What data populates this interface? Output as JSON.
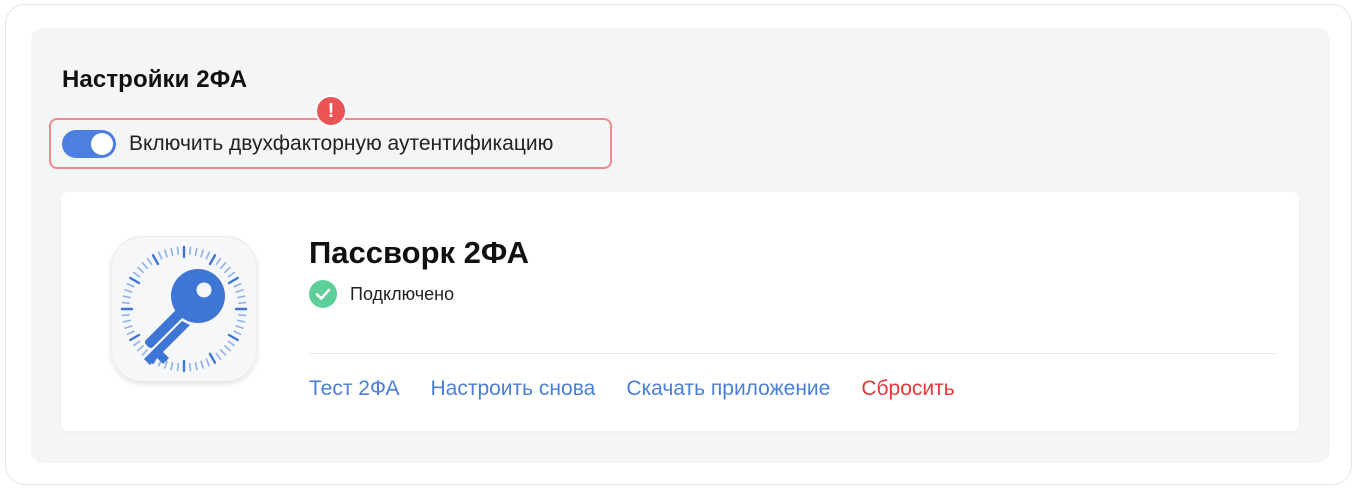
{
  "settings": {
    "title": "Настройки 2ФА",
    "alert_mark": "!",
    "toggle": {
      "label": "Включить двухфакторную аутентификацию",
      "state": "on"
    }
  },
  "provider": {
    "name": "Пассворк 2ФА",
    "status": "Подключено",
    "actions": {
      "test": "Тест 2ФА",
      "reconfigure": "Настроить снова",
      "download": "Скачать приложение",
      "reset": "Сбросить"
    }
  },
  "colors": {
    "accent": "#4b7fe0",
    "link": "#4a7fd8",
    "danger": "#e8363b",
    "success": "#5ccf9a",
    "alert": "#ea5455",
    "panel_background": "#f4f5f7"
  },
  "icons": {
    "app": "key-icon",
    "status": "check-circle-icon",
    "alert": "exclamation-icon"
  }
}
